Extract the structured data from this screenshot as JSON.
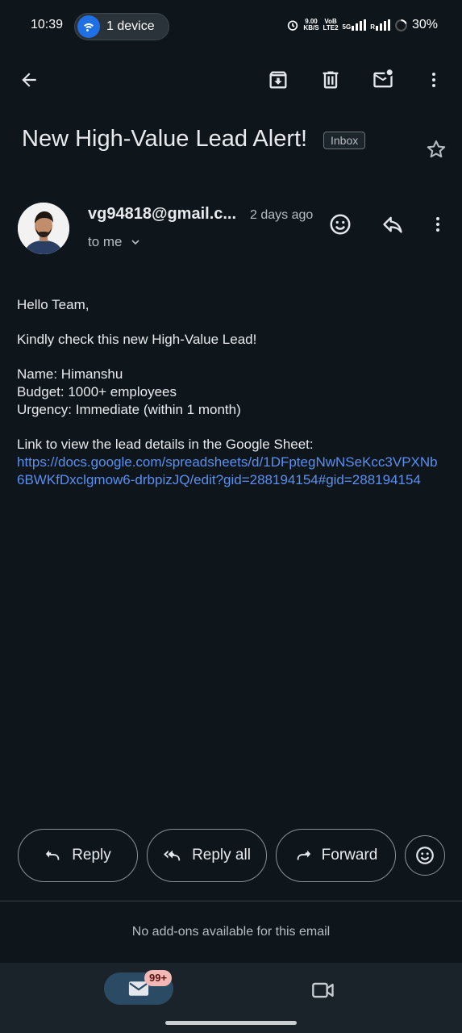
{
  "status_bar": {
    "time": "10:39",
    "device_pill": "1 device",
    "net_speed_top": "9.00",
    "net_speed_bottom": "KB/S",
    "volte_top": "VoB",
    "volte_bottom": "LTE2",
    "fiveg": "5G",
    "roaming": "R",
    "battery": "30%"
  },
  "toolbar": {
    "back_icon": "arrow-left-icon",
    "archive_icon": "archive-icon",
    "delete_icon": "trash-icon",
    "mark_unread_icon": "mail-unread-icon",
    "more_icon": "more-vert-icon"
  },
  "email": {
    "subject": "New High-Value Lead Alert!",
    "label": "Inbox",
    "sender": "vg94818@gmail.c...",
    "time_ago": "2 days ago",
    "recipient": "to me",
    "greeting": "Hello Team,",
    "line1": "Kindly check this new High-Value Lead!",
    "name_line": "Name: Himanshu",
    "budget_line": "Budget:  1000+ employees",
    "urgency_line": "Urgency: Immediate (within 1 month)",
    "link_intro": "Link to view the lead details in the Google Sheet:",
    "link_url": "https://docs.google.com/spreadsheets/d/1DFptegNwNSeKcc3VPXNb6BWKfDxclgmow6-drbpizJQ/edit?gid=288194154#gid=288194154"
  },
  "actions": {
    "reply": "Reply",
    "reply_all": "Reply all",
    "forward": "Forward"
  },
  "addons_text": "No add-ons available for this email",
  "bottom_nav": {
    "mail_badge": "99+"
  },
  "colors": {
    "background": "#0e161c",
    "link": "#5a8ff0",
    "accent_blue": "#1f6fe5",
    "nav_active": "#2b4a63",
    "badge": "#f2b8b5"
  }
}
